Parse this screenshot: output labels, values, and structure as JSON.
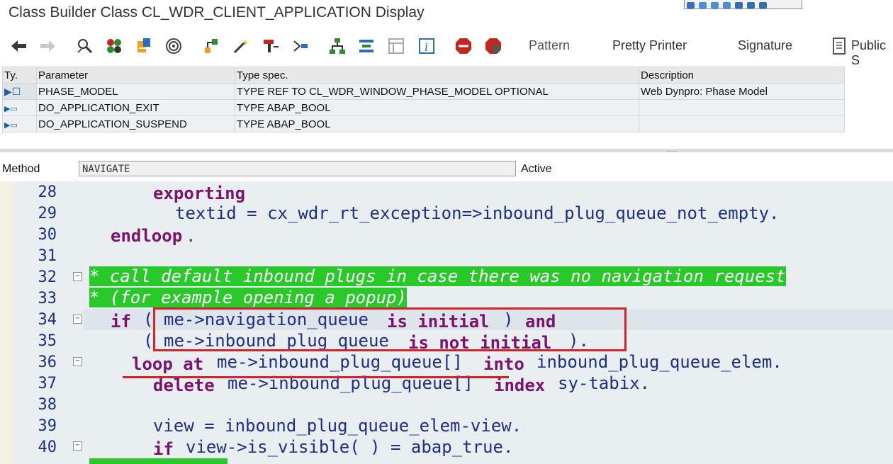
{
  "window": {
    "title": "Class Builder Class CL_WDR_CLIENT_APPLICATION Display"
  },
  "toolbar": {
    "pattern_label": "Pattern",
    "pretty_printer_label": "Pretty Printer",
    "signature_label": "Signature",
    "public_label": "Public S"
  },
  "params": {
    "headers": {
      "type": "Ty.",
      "parameter": "Parameter",
      "typespec": "Type spec.",
      "description": "Description"
    },
    "rows": [
      {
        "parameter": "PHASE_MODEL",
        "typespec": "TYPE REF TO CL_WDR_WINDOW_PHASE_MODEL OPTIONAL",
        "description": "Web Dynpro: Phase Model"
      },
      {
        "parameter": "DO_APPLICATION_EXIT",
        "typespec": "TYPE ABAP_BOOL",
        "description": ""
      },
      {
        "parameter": "DO_APPLICATION_SUSPEND",
        "typespec": "TYPE ABAP_BOOL",
        "description": ""
      }
    ]
  },
  "method": {
    "label": "Method",
    "name": "NAVIGATE",
    "status": "Active"
  },
  "editor": {
    "line_numbers": [
      "28",
      "29",
      "30",
      "31",
      "32",
      "33",
      "34",
      "35",
      "36",
      "37",
      "38",
      "39",
      "40"
    ],
    "lines": {
      "l28_kw": "exporting",
      "l29_text": "textid = cx_wdr_rt_exception=>inbound_plug_queue_not_empty.",
      "l30_kw": "endloop",
      "l30_end": ".",
      "l32_comment": "* call default inbound plugs in case there was no navigation request",
      "l33_comment": "* (for example opening a popup)",
      "l34_kw": "if",
      "l34_paren": "(",
      "l34_expr": "me->navigation_queue",
      "l34_kw2": "is initial",
      "l34_close": ")",
      "l34_kw3": "and",
      "l35_paren": "(",
      "l35_expr": "me->inbound_plug_queue",
      "l35_kw2": "is not initial",
      "l35_close": ").",
      "l36_kw": "loop at",
      "l36_expr": "me->inbound_plug_queue[]",
      "l36_kw2": "into",
      "l36_tail": "inbound_plug_queue_elem.",
      "l37_kw": "delete",
      "l37_expr": "me->inbound_plug_queue[]",
      "l37_kw2": "index",
      "l37_tail": "sy-tabix.",
      "l39_text": "view = inbound_plug_queue_elem-view.",
      "l40_kw": "if",
      "l40_text": "view->is_visible( ) = abap_true."
    }
  },
  "colors": {
    "comment_bg": "#2ac92a",
    "keyword": "#7c1170",
    "identifier": "#1e2e8a",
    "annotation": "#d3232a"
  }
}
